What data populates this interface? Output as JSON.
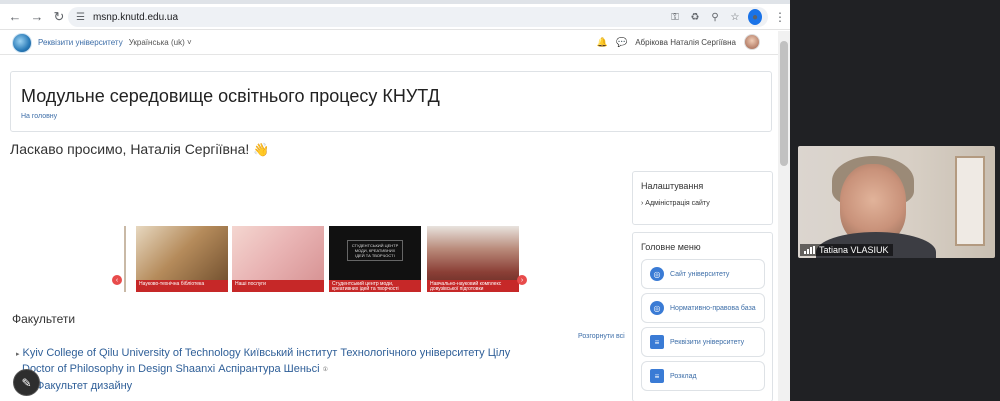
{
  "browser": {
    "url": "msnp.knutd.edu.ua"
  },
  "navbar": {
    "site_link": "Реквізити університету",
    "language": "Українська (uk)",
    "username": "Абрікова Наталія Сергіївна"
  },
  "page": {
    "title": "Модульне середовище освітнього процесу КНУТД",
    "breadcrumb": "На головну",
    "welcome": "Ласкаво просимо, Наталія Сергіївна!",
    "welcome_emoji": "👋"
  },
  "slider": {
    "slides": [
      {
        "caption": "Науково-технічна бібліотека"
      },
      {
        "caption": "Наші послуги"
      },
      {
        "caption": "Студентський центр моди, креативних ідей та творчості",
        "slogan": "СТУДЕНТСЬКИЙ ЦЕНТР МОДИ, КРЕАТИВНИХ ІДЕЙ ТА ТВОРЧОСТІ"
      },
      {
        "caption": "Навчально-науковий комплекс довузівської підготовки"
      }
    ]
  },
  "faculties": {
    "title": "Факультети",
    "expand_all": "Розгорнути всі",
    "items": [
      "Kyiv College of Qilu University of Technology Київський інститут Технологічного університету Цілу",
      "Doctor of Philosophy in Design Shaanxi Аспірантура Шеньсі",
      "Факультет дизайну"
    ],
    "badge": "①"
  },
  "sidebar": {
    "settings_title": "Налаштування",
    "settings_link": "Адміністрація сайту",
    "menu_title": "Головне меню",
    "menu_items": [
      {
        "label": "Сайт університету",
        "icon": "globe-icon"
      },
      {
        "label": "Нормативно-правова база",
        "icon": "globe-icon"
      },
      {
        "label": "Реквізити університету",
        "icon": "document-icon"
      },
      {
        "label": "Розклад",
        "icon": "document-icon"
      }
    ]
  },
  "video": {
    "participant_name": "Tatiana VLASIUK"
  },
  "colors": {
    "link": "#3d6ea8",
    "slide_caption": "#c62828",
    "menu_icon": "#3a7bd5"
  }
}
